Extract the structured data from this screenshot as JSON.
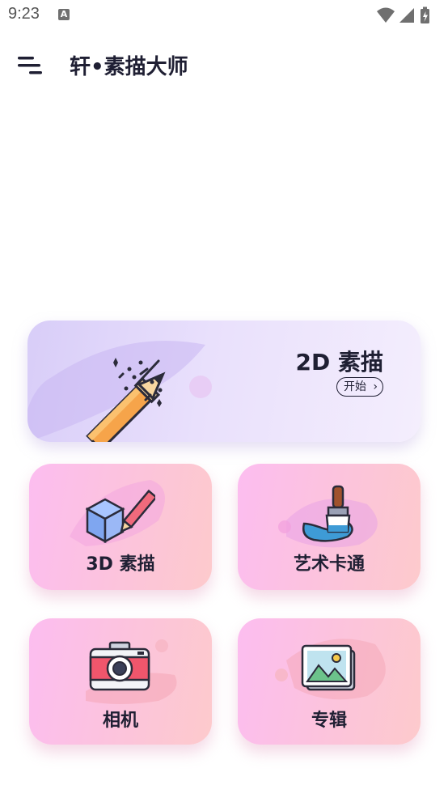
{
  "status_bar": {
    "time": "9:23",
    "notification_letter": "A"
  },
  "app_bar": {
    "title": "轩•素描大师"
  },
  "main": {
    "feature_2d": {
      "title": "2D 素描",
      "action_label": "开始"
    },
    "tiles": [
      {
        "label": "3D 素描",
        "icon": "cube-pencil-icon"
      },
      {
        "label": "艺术卡通",
        "icon": "paint-brush-icon"
      },
      {
        "label": "相机",
        "icon": "camera-icon"
      },
      {
        "label": "专辑",
        "icon": "photo-album-icon"
      }
    ]
  },
  "colors": {
    "title_text": "#1f1f33",
    "card_2d_start": "#d8cdf8",
    "card_pink_start": "#fcbdf0",
    "card_pink_end": "#fdcacc"
  }
}
